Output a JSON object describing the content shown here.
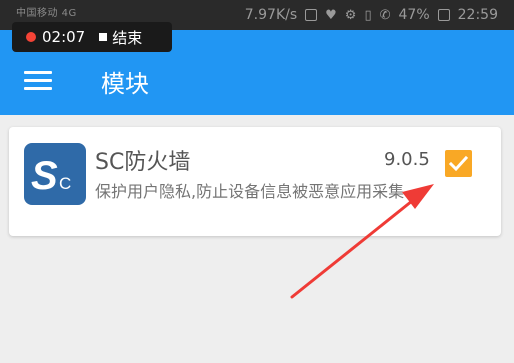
{
  "status_bar": {
    "carrier_text": "中国移动 4G",
    "speed": "7.97K/s",
    "battery": "47%",
    "time": "22:59"
  },
  "recorder": {
    "elapsed": "02:07",
    "stop_label": "结束",
    "dot_color": "#f44336"
  },
  "app_bar": {
    "title": "模块",
    "color": "#2196f3",
    "menu_icon": "hamburger-menu-icon"
  },
  "module": {
    "name": "SC防火墙",
    "description": "保护用户隐私,防止设备信息被恶意应用采集",
    "version": "9.0.5",
    "enabled": true,
    "icon_color": "#2f6aa8",
    "check_color": "#f9a825"
  },
  "annotation": {
    "arrow_color": "#ef3b36"
  }
}
